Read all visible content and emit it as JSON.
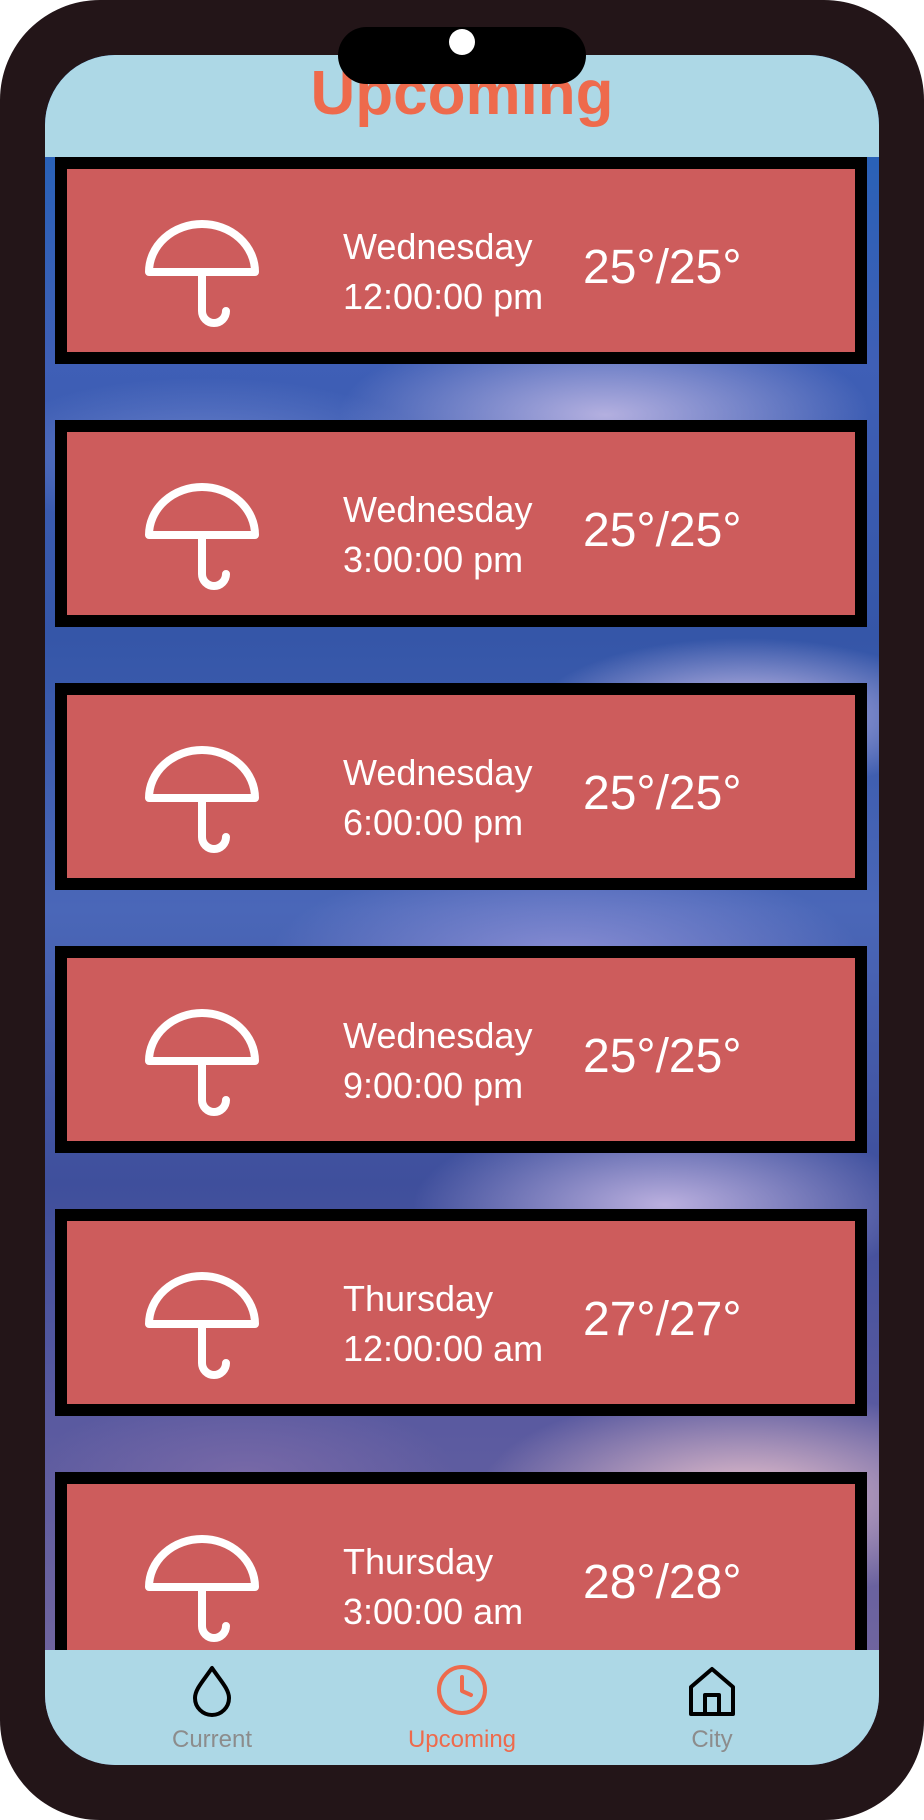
{
  "header": {
    "title": "Upcoming"
  },
  "forecast": [
    {
      "day": "Wednesday",
      "time": "12:00:00 pm",
      "temp": "25°/25°",
      "icon": "umbrella-icon"
    },
    {
      "day": "Wednesday",
      "time": "3:00:00 pm",
      "temp": "25°/25°",
      "icon": "umbrella-icon"
    },
    {
      "day": "Wednesday",
      "time": "6:00:00 pm",
      "temp": "25°/25°",
      "icon": "umbrella-icon"
    },
    {
      "day": "Wednesday",
      "time": "9:00:00 pm",
      "temp": "25°/25°",
      "icon": "umbrella-icon"
    },
    {
      "day": "Thursday",
      "time": "12:00:00 am",
      "temp": "27°/27°",
      "icon": "umbrella-icon"
    },
    {
      "day": "Thursday",
      "time": "3:00:00 am",
      "temp": "28°/28°",
      "icon": "umbrella-icon"
    }
  ],
  "nav": {
    "items": [
      {
        "label": "Current",
        "icon": "droplet-icon",
        "active": false
      },
      {
        "label": "Upcoming",
        "icon": "clock-icon",
        "active": true
      },
      {
        "label": "City",
        "icon": "home-icon",
        "active": false
      }
    ]
  },
  "colors": {
    "accent": "#ee6a4c",
    "bar_background": "#add8e6",
    "card_background": "#cd5c5c",
    "card_border": "#000000",
    "inactive_nav": "#8c8c8c",
    "device_frame": "#231518"
  }
}
